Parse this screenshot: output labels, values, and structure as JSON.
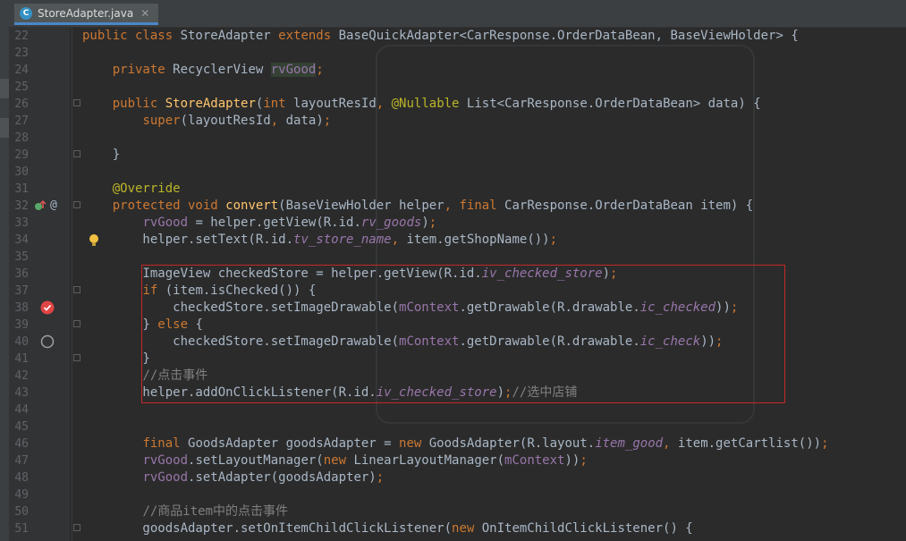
{
  "tab": {
    "icon_label": "C",
    "title": "StoreAdapter.java",
    "close": "✕"
  },
  "lines": [
    {
      "n": "22",
      "t": [
        {
          "c": "kw",
          "s": "public class "
        },
        {
          "c": "",
          "s": "StoreAdapter "
        },
        {
          "c": "kw",
          "s": "extends "
        },
        {
          "c": "",
          "s": "BaseQuickAdapter<CarResponse.OrderDataBean, BaseViewHolder> {"
        }
      ]
    },
    {
      "n": "23",
      "t": []
    },
    {
      "n": "24",
      "t": [
        {
          "c": "",
          "s": "    "
        },
        {
          "c": "kw",
          "s": "private "
        },
        {
          "c": "",
          "s": "RecyclerView "
        },
        {
          "c": "fld hl",
          "s": "rvGood"
        },
        {
          "c": "kw",
          "s": ";"
        }
      ]
    },
    {
      "n": "25",
      "t": []
    },
    {
      "n": "26",
      "t": [
        {
          "c": "",
          "s": "    "
        },
        {
          "c": "kw",
          "s": "public "
        },
        {
          "c": "fn",
          "s": "StoreAdapter"
        },
        {
          "c": "",
          "s": "("
        },
        {
          "c": "kw",
          "s": "int "
        },
        {
          "c": "",
          "s": "layoutResId"
        },
        {
          "c": "kw",
          "s": ", "
        },
        {
          "c": "ann",
          "s": "@Nullable "
        },
        {
          "c": "",
          "s": "List<CarResponse.OrderDataBean> data) {"
        }
      ]
    },
    {
      "n": "27",
      "t": [
        {
          "c": "",
          "s": "        "
        },
        {
          "c": "kw",
          "s": "super"
        },
        {
          "c": "",
          "s": "(layoutResId"
        },
        {
          "c": "kw",
          "s": ", "
        },
        {
          "c": "",
          "s": "data)"
        },
        {
          "c": "kw",
          "s": ";"
        }
      ]
    },
    {
      "n": "28",
      "t": []
    },
    {
      "n": "29",
      "t": [
        {
          "c": "",
          "s": "    }"
        }
      ]
    },
    {
      "n": "30",
      "t": []
    },
    {
      "n": "31",
      "t": [
        {
          "c": "",
          "s": "    "
        },
        {
          "c": "ann",
          "s": "@Override"
        }
      ]
    },
    {
      "n": "32",
      "t": [
        {
          "c": "",
          "s": "    "
        },
        {
          "c": "kw",
          "s": "protected void "
        },
        {
          "c": "fn",
          "s": "convert"
        },
        {
          "c": "",
          "s": "(BaseViewHolder helper"
        },
        {
          "c": "kw",
          "s": ", final "
        },
        {
          "c": "",
          "s": "CarResponse.OrderDataBean item) {"
        }
      ]
    },
    {
      "n": "33",
      "t": [
        {
          "c": "",
          "s": "        "
        },
        {
          "c": "fld",
          "s": "rvGood "
        },
        {
          "c": "",
          "s": "= helper.getView(R.id."
        },
        {
          "c": "fldi",
          "s": "rv_goods"
        },
        {
          "c": "",
          "s": ")"
        },
        {
          "c": "kw",
          "s": ";"
        }
      ]
    },
    {
      "n": "34",
      "t": [
        {
          "c": "",
          "s": "        helper.setText(R.id."
        },
        {
          "c": "fldi",
          "s": "tv_store_name"
        },
        {
          "c": "kw",
          "s": ", "
        },
        {
          "c": "",
          "s": "item.getShopName())"
        },
        {
          "c": "kw",
          "s": ";"
        }
      ]
    },
    {
      "n": "35",
      "t": []
    },
    {
      "n": "36",
      "t": [
        {
          "c": "",
          "s": "        ImageView checkedStore = helper.getView(R.id."
        },
        {
          "c": "fldi",
          "s": "iv_checked_store"
        },
        {
          "c": "",
          "s": ")"
        },
        {
          "c": "kw",
          "s": ";"
        }
      ]
    },
    {
      "n": "37",
      "t": [
        {
          "c": "",
          "s": "        "
        },
        {
          "c": "kw",
          "s": "if "
        },
        {
          "c": "",
          "s": "(item.isChecked()) {"
        }
      ]
    },
    {
      "n": "38",
      "t": [
        {
          "c": "",
          "s": "            checkedStore.setImageDrawable("
        },
        {
          "c": "fld",
          "s": "mContext"
        },
        {
          "c": "",
          "s": ".getDrawable(R.drawable."
        },
        {
          "c": "fldi",
          "s": "ic_checked"
        },
        {
          "c": "",
          "s": "))"
        },
        {
          "c": "kw",
          "s": ";"
        }
      ]
    },
    {
      "n": "39",
      "t": [
        {
          "c": "",
          "s": "        } "
        },
        {
          "c": "kw",
          "s": "else "
        },
        {
          "c": "",
          "s": "{"
        }
      ]
    },
    {
      "n": "40",
      "t": [
        {
          "c": "",
          "s": "            checkedStore.setImageDrawable("
        },
        {
          "c": "fld",
          "s": "mContext"
        },
        {
          "c": "",
          "s": ".getDrawable(R.drawable."
        },
        {
          "c": "fldi",
          "s": "ic_check"
        },
        {
          "c": "",
          "s": "))"
        },
        {
          "c": "kw",
          "s": ";"
        }
      ]
    },
    {
      "n": "41",
      "t": [
        {
          "c": "",
          "s": "        }"
        }
      ]
    },
    {
      "n": "42",
      "t": [
        {
          "c": "",
          "s": "        "
        },
        {
          "c": "cmt",
          "s": "//点击事件"
        }
      ]
    },
    {
      "n": "43",
      "t": [
        {
          "c": "",
          "s": "        helper.addOnClickListener(R.id."
        },
        {
          "c": "fldi",
          "s": "iv_checked_store"
        },
        {
          "c": "",
          "s": ")"
        },
        {
          "c": "kw",
          "s": ";"
        },
        {
          "c": "cmt",
          "s": "//选中店铺"
        }
      ]
    },
    {
      "n": "44",
      "t": []
    },
    {
      "n": "45",
      "t": []
    },
    {
      "n": "46",
      "t": [
        {
          "c": "",
          "s": "        "
        },
        {
          "c": "kw",
          "s": "final "
        },
        {
          "c": "",
          "s": "GoodsAdapter goodsAdapter = "
        },
        {
          "c": "kw",
          "s": "new "
        },
        {
          "c": "",
          "s": "GoodsAdapter(R.layout."
        },
        {
          "c": "fldi",
          "s": "item_good"
        },
        {
          "c": "kw",
          "s": ", "
        },
        {
          "c": "",
          "s": "item.getCartlist())"
        },
        {
          "c": "kw",
          "s": ";"
        }
      ]
    },
    {
      "n": "47",
      "t": [
        {
          "c": "",
          "s": "        "
        },
        {
          "c": "fld",
          "s": "rvGood"
        },
        {
          "c": "",
          "s": ".setLayoutManager("
        },
        {
          "c": "kw",
          "s": "new "
        },
        {
          "c": "",
          "s": "LinearLayoutManager("
        },
        {
          "c": "fld",
          "s": "mContext"
        },
        {
          "c": "",
          "s": "))"
        },
        {
          "c": "kw",
          "s": ";"
        }
      ]
    },
    {
      "n": "48",
      "t": [
        {
          "c": "",
          "s": "        "
        },
        {
          "c": "fld",
          "s": "rvGood"
        },
        {
          "c": "",
          "s": ".setAdapter(goodsAdapter)"
        },
        {
          "c": "kw",
          "s": ";"
        }
      ]
    },
    {
      "n": "49",
      "t": []
    },
    {
      "n": "50",
      "t": [
        {
          "c": "",
          "s": "        "
        },
        {
          "c": "cmt",
          "s": "//商品item中的点击事件"
        }
      ]
    },
    {
      "n": "51",
      "t": [
        {
          "c": "",
          "s": "        goodsAdapter.setOnItemChildClickListener("
        },
        {
          "c": "kw",
          "s": "new "
        },
        {
          "c": "",
          "s": "OnItemChildClickListener() {"
        }
      ]
    }
  ],
  "gutter_icons": {
    "line32": [
      "override-icon",
      "annotation-at-icon"
    ],
    "line34": "bulb-icon",
    "line38": "breakpoint-icon",
    "line40": "empty-breakpoint-icon"
  },
  "colors": {
    "background": "#2b2b2b",
    "keyword": "#cc7832",
    "field": "#9876aa",
    "method": "#ffc66d",
    "annotation": "#bbb529",
    "comment": "#808080",
    "highlight_box": "#c62828"
  }
}
